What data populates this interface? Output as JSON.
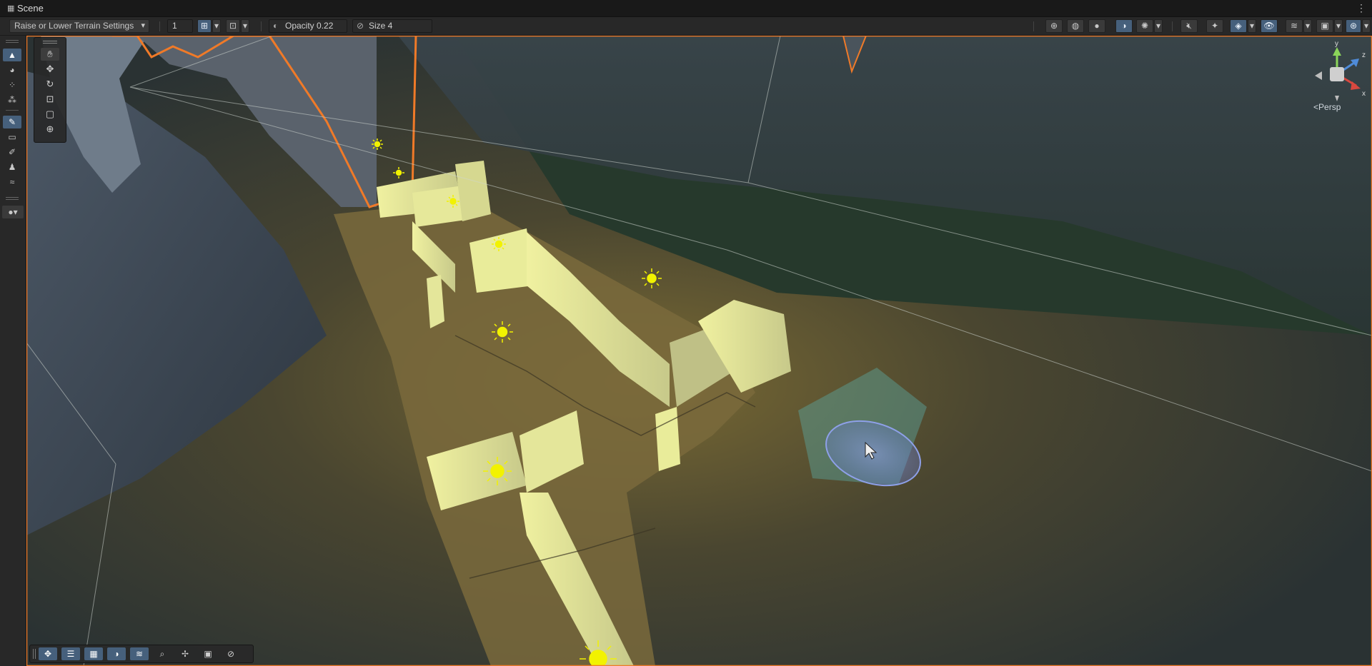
{
  "window": {
    "title": "Scene",
    "more_icon": "⋮"
  },
  "toolbar": {
    "terrain_tool_dropdown": "Raise or Lower Terrain Settings",
    "grid_value": "1",
    "opacity_label": "Opacity 0.22",
    "size_label": "Size 4",
    "icons_left": [
      "grid-snap-icon",
      "increment-snap-icon"
    ],
    "icons_right": [
      "orientation-gizmo-icon",
      "shading-wireframe-icon",
      "shading-shaded-icon",
      "shading-unlit-icon",
      "debug-icon",
      "audio-mute-icon",
      "effects-icon",
      "gizmos-icon",
      "visibility-icon",
      "layers-icon",
      "camera-icon",
      "scene-view-options-icon"
    ]
  },
  "left_tools": [
    "terrain-paint-icon",
    "sculpt-icon",
    "detail-icon",
    "trees-icon",
    "raise-lower-icon",
    "set-height-icon",
    "smooth-icon",
    "stamp-icon",
    "holes-icon",
    "brush-icon"
  ],
  "scene_tools": [
    "hand-icon",
    "move-icon",
    "rotate-icon",
    "scale-icon",
    "rect-icon",
    "transform-icon"
  ],
  "bottom_overlay": [
    "move-icon",
    "panels-icon",
    "grid-icon",
    "shading-icon",
    "layers-icon",
    "search-icon",
    "pivot-icon",
    "camera-icon",
    "compass-icon"
  ],
  "gizmo": {
    "axis_y": "y",
    "axis_z": "z",
    "axis_x": "x",
    "projection_label": "Persp"
  },
  "colors": {
    "selection_outline": "#f07a28",
    "light_icon": "#f2f200",
    "toolbar_active": "#46607c",
    "brush_preview": "#6a7fd8"
  }
}
